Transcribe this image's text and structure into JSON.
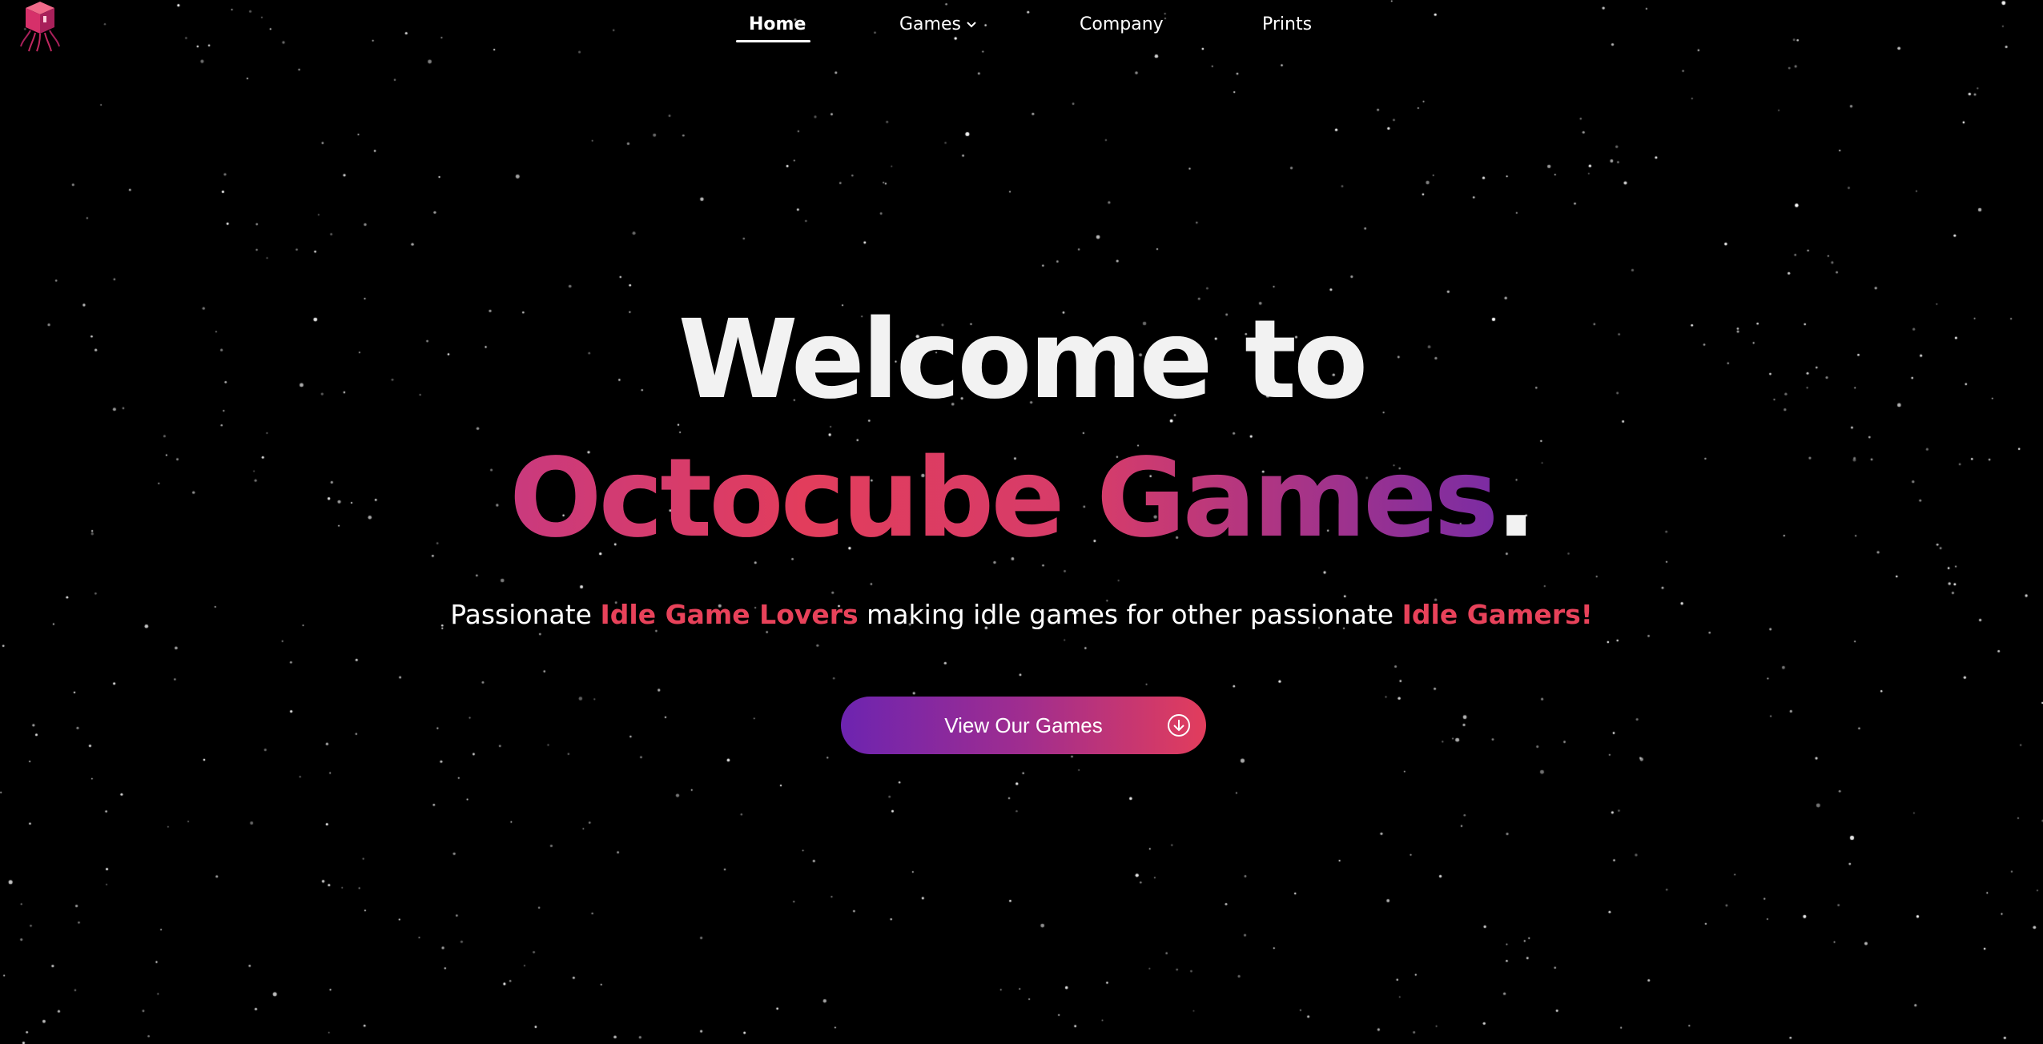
{
  "nav": {
    "items": [
      {
        "label": "Home",
        "active": true
      },
      {
        "label": "Games",
        "has_dropdown": true
      },
      {
        "label": "Company"
      },
      {
        "label": "Prints"
      }
    ]
  },
  "logo": {
    "icon": "octocube-logo-icon"
  },
  "hero": {
    "line1": "Welcome to",
    "line2_brand": "Octocube Games",
    "line2_dot": "."
  },
  "tagline": {
    "part1": "Passionate ",
    "highlight1": "Idle Game Lovers",
    "part2": " making idle games for other passionate ",
    "highlight2": "Idle Gamers!"
  },
  "cta": {
    "label": "View Our Games",
    "icon": "arrow-down-circle-icon"
  },
  "colors": {
    "background": "#000000",
    "accent": "#e8425a",
    "gradient_start": "#6d24b0",
    "gradient_end": "#e23d5c"
  }
}
